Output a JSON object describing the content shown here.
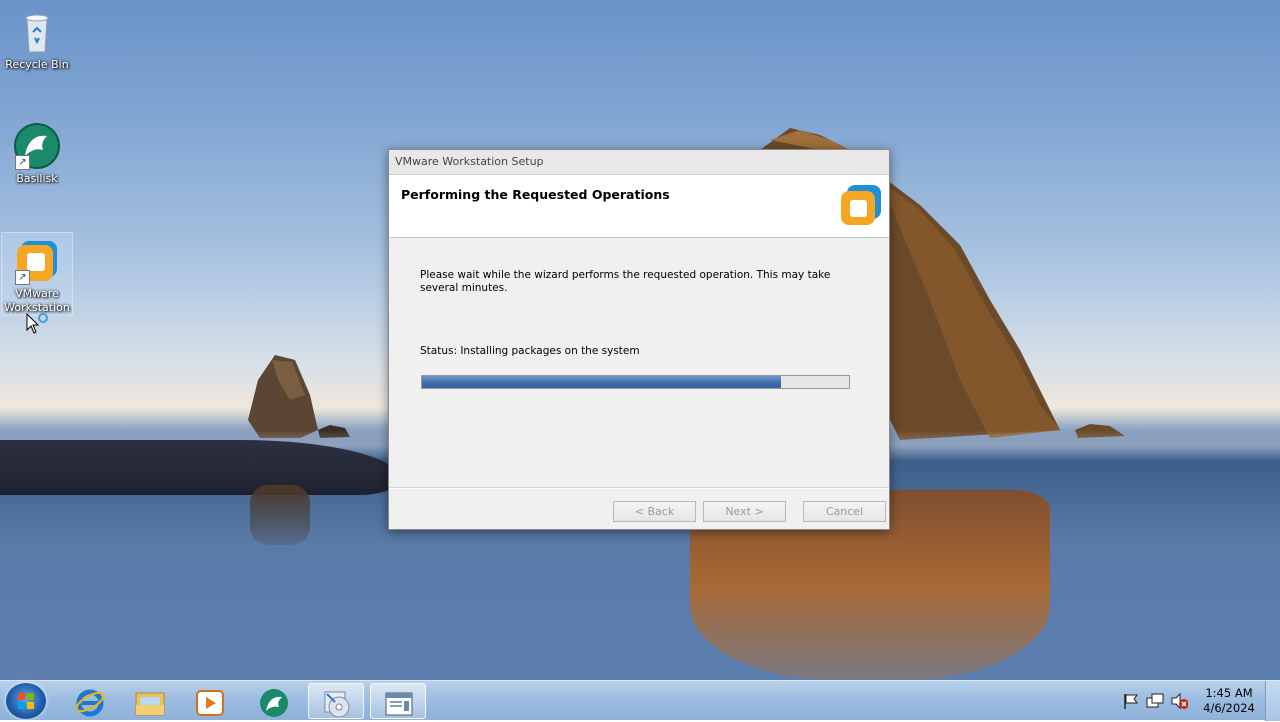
{
  "desktop": {
    "icons": [
      {
        "label": "Recycle Bin",
        "icon": "recycle-bin-icon"
      },
      {
        "label": "Basilisk",
        "icon": "basilisk-icon"
      },
      {
        "label": "VMware Workstation",
        "icon": "vmware-icon"
      }
    ]
  },
  "dialog": {
    "title": "VMware Workstation Setup",
    "header": "Performing the Requested Operations",
    "description": "Please wait while the wizard performs the requested operation. This may take several minutes.",
    "status": "Status: Installing packages on the system",
    "progress_percent": 84,
    "buttons": {
      "back": "< Back",
      "next": "Next >",
      "cancel": "Cancel"
    }
  },
  "taskbar": {
    "items": [
      {
        "name": "internet-explorer",
        "icon": "internet-explorer-icon"
      },
      {
        "name": "file-explorer",
        "icon": "folder-icon"
      },
      {
        "name": "media-player",
        "icon": "media-player-icon"
      },
      {
        "name": "basilisk",
        "icon": "basilisk-icon"
      },
      {
        "name": "vmware-installer",
        "icon": "installer-cd-icon",
        "active": true
      },
      {
        "name": "setup-window",
        "icon": "window-icon",
        "active": true
      }
    ],
    "tray": {
      "icons": [
        "flag-icon",
        "network-icon",
        "volume-muted-icon"
      ],
      "time": "1:45 AM",
      "date": "4/6/2024"
    }
  },
  "colors": {
    "progress": "#3f6fae",
    "taskbar": "#9bbbe0",
    "vmware_orange": "#f5a623",
    "vmware_blue": "#1f8fd6"
  }
}
